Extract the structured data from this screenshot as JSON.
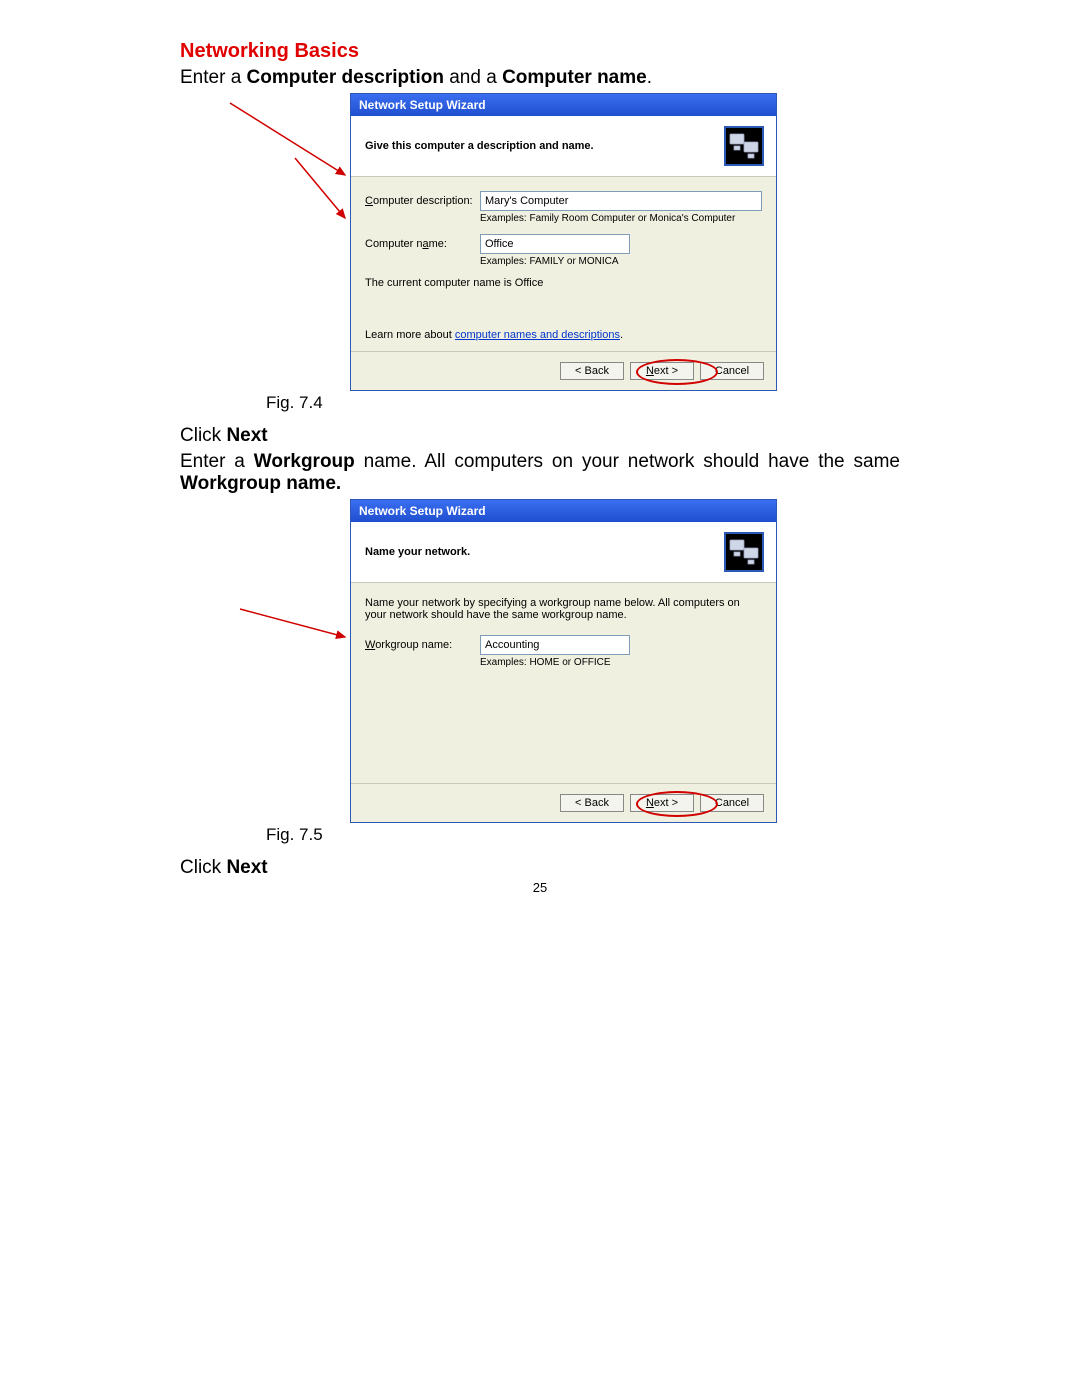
{
  "section_title": "Networking Basics",
  "instr1_pre": "Enter a ",
  "instr1_b1": "Computer description",
  "instr1_mid": " and a ",
  "instr1_b2": "Computer name",
  "instr1_post": ".",
  "wizard1": {
    "title": "Network Setup Wizard",
    "header": "Give this computer a description and name.",
    "desc_label_u": "C",
    "desc_label_rest": "omputer description:",
    "desc_value": "Mary's Computer",
    "desc_examples": "Examples: Family Room Computer or Monica's Computer",
    "name_label_rest": "Computer n",
    "name_label_u": "a",
    "name_label_rest2": "me:",
    "name_value": "Office",
    "name_examples": "Examples: FAMILY or MONICA",
    "current_pre": "The current computer name is ",
    "current_val": "Office",
    "learn_pre": "Learn more about ",
    "learn_link": "computer names and descriptions",
    "learn_post": ".",
    "back": "< Back",
    "next_u": "N",
    "next_rest": "ext >",
    "cancel": "Cancel"
  },
  "caption1": "Fig. 7.4",
  "click_next_pre": "Click ",
  "click_next_b": "Next",
  "instr2_pre": "Enter a ",
  "instr2_b1": "Workgroup",
  "instr2_mid": " name.  All computers on your network should have the same ",
  "instr2_b2": "Workgroup name.",
  "wizard2": {
    "title": "Network Setup Wizard",
    "header": "Name your network.",
    "bodytext": "Name your network by specifying a workgroup name below. All computers on your network should have the same workgroup name.",
    "wg_label_u": "W",
    "wg_label_rest": "orkgroup name:",
    "wg_value": "Accounting",
    "wg_examples": "Examples: HOME or OFFICE",
    "back": "< Back",
    "next_u": "N",
    "next_rest": "ext >",
    "cancel": "Cancel"
  },
  "caption2": "Fig. 7.5",
  "page_number": "25"
}
